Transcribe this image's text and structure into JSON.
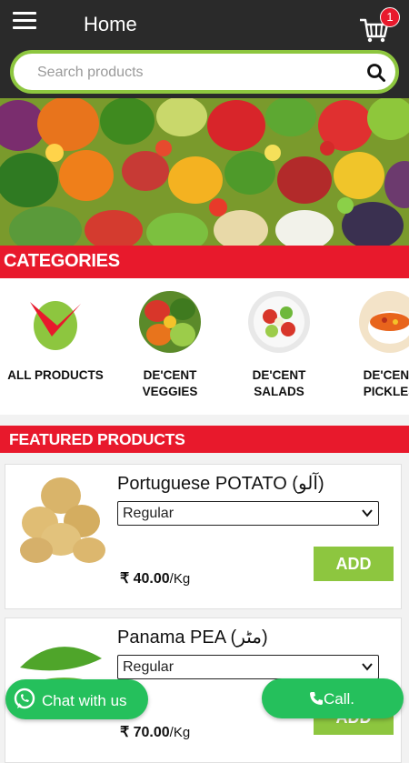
{
  "header": {
    "title": "Home",
    "cart_count": "1"
  },
  "search": {
    "placeholder": "Search products"
  },
  "categories": {
    "heading": "CATEGORIES",
    "items": [
      {
        "label": "ALL PRODUCTS"
      },
      {
        "label": "DE'CENT VEGGIES"
      },
      {
        "label": "DE'CENT SALADS"
      },
      {
        "label": "DE'CENT PICKLES"
      }
    ]
  },
  "featured": {
    "heading": "FEATURED PRODUCTS",
    "products": [
      {
        "name": "Portuguese POTATO (آلو)",
        "variant": "Regular",
        "add_label": "ADD",
        "price": "₹ 40.00",
        "unit": "/Kg"
      },
      {
        "name": "Panama PEA (مٹر)",
        "variant": "Regular",
        "add_label": "ADD",
        "price": "₹ 70.00",
        "unit": "/Kg"
      }
    ]
  },
  "actions": {
    "chat_label": "Chat with us",
    "call_label": "Call."
  },
  "colors": {
    "brand_red": "#e8192c",
    "accent_green": "#8dc63f",
    "whatsapp_green": "#25c05c",
    "header_bg": "#2a2a2a"
  }
}
